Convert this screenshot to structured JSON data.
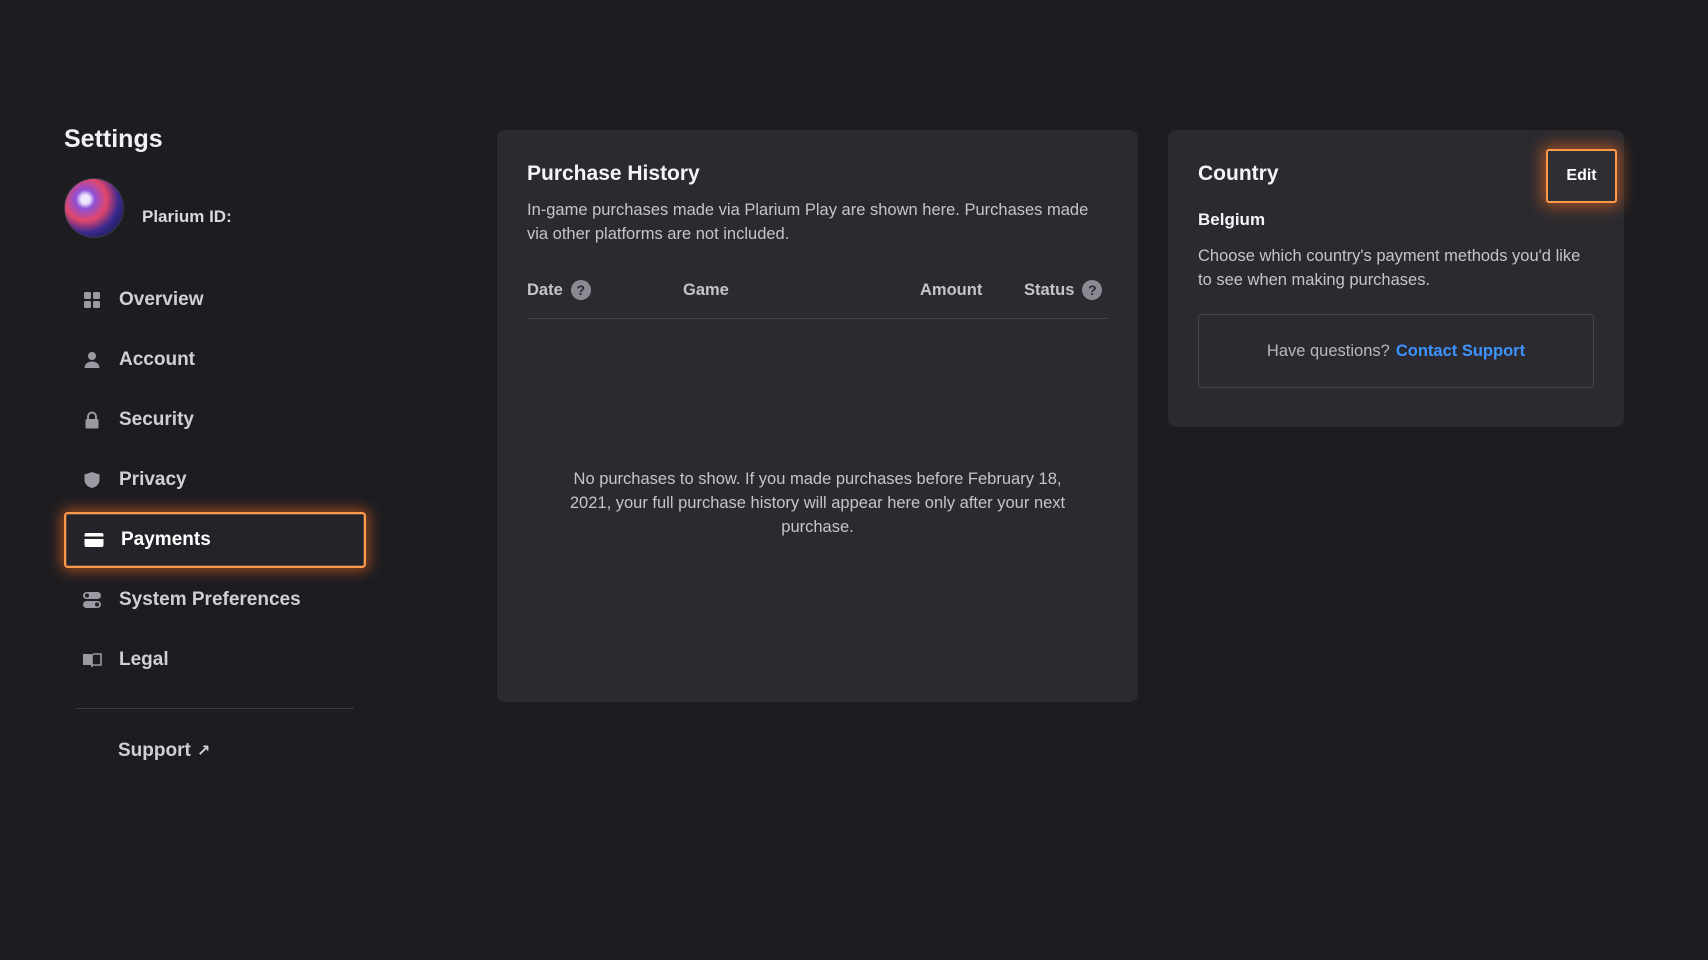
{
  "sidebar": {
    "title": "Settings",
    "profile": {
      "id_label": "Plarium ID:"
    },
    "items": [
      {
        "label": "Overview",
        "icon": "grid-icon",
        "active": false
      },
      {
        "label": "Account",
        "icon": "user-icon",
        "active": false
      },
      {
        "label": "Security",
        "icon": "lock-icon",
        "active": false
      },
      {
        "label": "Privacy",
        "icon": "shield-icon",
        "active": false
      },
      {
        "label": "Payments",
        "icon": "credit-card-icon",
        "active": true
      },
      {
        "label": "System Preferences",
        "icon": "toggles-icon",
        "active": false
      },
      {
        "label": "Legal",
        "icon": "book-icon",
        "active": false
      }
    ],
    "support": {
      "label": "Support",
      "icon": "external-link-icon"
    }
  },
  "purchase_history": {
    "title": "Purchase History",
    "description": "In-game purchases made via Plarium Play are shown here. Purchases made via other platforms are not included.",
    "columns": {
      "date": "Date",
      "game": "Game",
      "amount": "Amount",
      "status": "Status"
    },
    "empty_message": "No purchases to show. If you made purchases before February 18, 2021, your full purchase history will appear here only after your next purchase."
  },
  "country": {
    "title": "Country",
    "edit_label": "Edit",
    "value": "Belgium",
    "description": "Choose which country's payment methods you'd like to see when making purchases.",
    "questions_text": "Have questions?",
    "contact_link": "Contact Support"
  },
  "colors": {
    "background": "#1c1c21",
    "card": "#2a2a30",
    "highlight": "#ff9a4a",
    "link": "#3d93ff"
  }
}
